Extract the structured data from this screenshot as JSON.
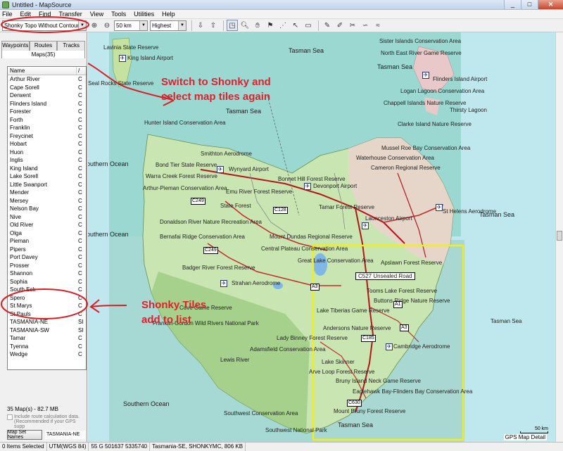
{
  "window": {
    "title": "Untitled - MapSource",
    "min": "_",
    "max": "□",
    "close": "✕"
  },
  "menu": [
    "File",
    "Edit",
    "Find",
    "Transfer",
    "View",
    "Tools",
    "Utilities",
    "Help"
  ],
  "toolbar": {
    "product": "Shonky Topo Without Contours",
    "scale": "50 km",
    "detail": "Highest"
  },
  "left_panel": {
    "tabs": [
      "Waypoints",
      "Routes",
      "Tracks"
    ],
    "maps_count": "Maps(35)",
    "columns": {
      "name": "Name",
      "sort": "/"
    },
    "maps": [
      "Arthur River",
      "Cape Sorell",
      "Derwent",
      "Flinders Island",
      "Forester",
      "Forth",
      "Franklin",
      "Freycinet",
      "Hobart",
      "Huon",
      "Inglis",
      "King Island",
      "Lake Sorell",
      "Little Swanport",
      "Mender",
      "Mersey",
      "Nelson Bay",
      "Nive",
      "Old River",
      "Olga",
      "Pieman",
      "Pipers",
      "Port Davey",
      "Prosser",
      "Shannon",
      "Sophia",
      "South Esk",
      "Spero",
      "St Marys",
      "St Pauls",
      "TASMANIA-NE",
      "TASMANIA-SW",
      "Tamar",
      "Tyenna",
      "Wedge"
    ],
    "col2": [
      "C",
      "C",
      "C",
      "C",
      "C",
      "C",
      "C",
      "C",
      "C",
      "C",
      "C",
      "C",
      "C",
      "C",
      "C",
      "C",
      "C",
      "C",
      "C",
      "C",
      "C",
      "C",
      "C",
      "C",
      "C",
      "C",
      "C",
      "C",
      "C",
      "C",
      "SI",
      "SI",
      "C",
      "C",
      "C"
    ],
    "size_status": "35 Map(s) - 82.7 MB",
    "route_calc": "Include route calculation data. (Recommended if your GPS supp",
    "mapset_button": "Map Set Names",
    "mapset_value": "TASMANIA-NE"
  },
  "annotations": {
    "top_line1": "Switch to Shonky and",
    "top_line2": "select map tiles again",
    "bottom_line1": "Shonky Tiles",
    "bottom_line2": "add to list"
  },
  "map_labels": {
    "seas": [
      "Tasman Sea",
      "Tasman Sea",
      "Tasman Sea",
      "Southern Ocean",
      "Southern Ocean",
      "Southern Ocean",
      "Tasman Sea",
      "Tasman Sea"
    ],
    "places": [
      "Lavinia State Reserve",
      "King Island Airport",
      "Seal Rocks State Reserve",
      "Hunter Island Conservation Area",
      "Bond Tier State Reserve",
      "Warra Creek Forest Reserve",
      "Arthur-Pieman Conservation Area",
      "Wynyard Airport",
      "Devonport Airport",
      "State Forest",
      "Donaldson River Nature Recreation Area",
      "Bernafai Ridge Conservation Area",
      "Badger River Forest Reserve",
      "Strahan Aerodrome",
      "Franklin-Gordon Wild Rivers National Park",
      "Lewis River",
      "Southwest Conservation Area",
      "Southwest National Park",
      "Sister Islands Conservation Area",
      "North East River Game Reserve",
      "Flinders Island Airport",
      "Logan Lagoon Conservation Area",
      "Chappell Islands Nature Reserve",
      "Clarke Island Nature Reserve",
      "Mussel Roe Bay Conservation Area",
      "Waterhouse Conservation Area",
      "Cameron Regional Reserve",
      "St Helens Aerodrome",
      "Launceston Airport",
      "Central Plateau Conservation Area",
      "Apslawn Forest Reserve",
      "Lake Skinner",
      "Lady Binney Forest Reserve",
      "Adamsfield Conservation Area",
      "Cambridge Aerodrome",
      "Bruny Island Neck Game Reserve",
      "Mount Bruny Forest Reserve",
      "Thirsty Lagoon",
      "Emu River Forest Reserve",
      "Tasman Sea",
      "Smithton Aerodrome",
      "Tooms Lake Forest Reserve",
      "Buttons Ridge Nature Reserve",
      "Lake Tiberias Game Reserve",
      "Andersons Nature Reserve",
      "Cove Game Reserve",
      "Great Lake Conservation Area",
      "Eaglehawk Bay-Flinders Bay Conservation Area",
      "Arve Loop Forest Reserve",
      "Bonnet Hill Forest Reserve",
      "Mount Dundas Regional Reserve",
      "Tamar Forest Reserve"
    ],
    "road_callout": "C527 Unsealed Road",
    "shields": [
      "C249",
      "C249",
      "C128",
      "A3",
      "A3",
      "C185",
      "C630",
      "A1"
    ]
  },
  "scale_label": "50 km",
  "gps_detail": "GPS Map Detail",
  "status": {
    "items": "0 Items Selected",
    "datum": "UTM(WGS 84)",
    "coord": "55 G 501637 5335740",
    "tile": "Tasmania-SE, SHONKYMC, 806 KB"
  }
}
